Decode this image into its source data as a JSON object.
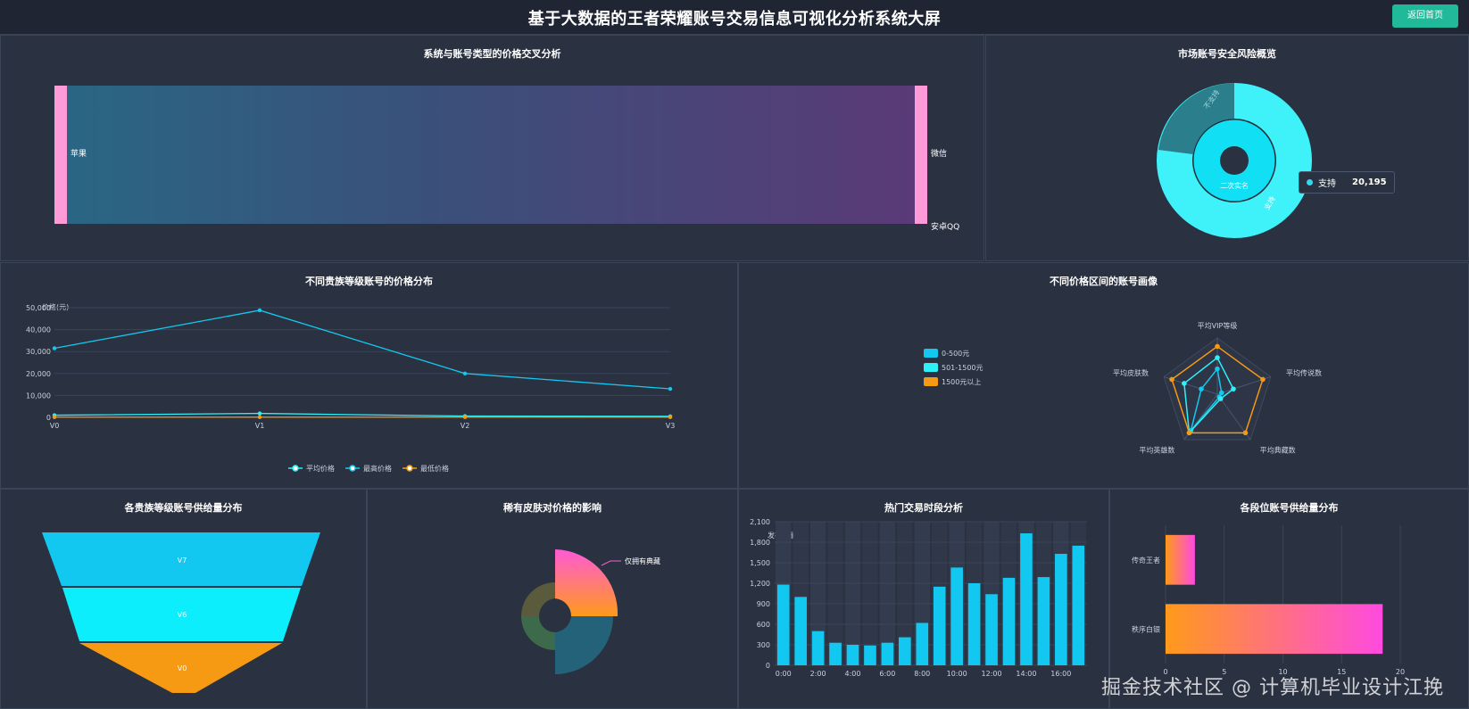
{
  "header": {
    "title": "基于大数据的王者荣耀账号交易信息可视化分析系统大屏",
    "home_button": "返回首页"
  },
  "colors": {
    "cyan": "#13c8f0",
    "cyan_light": "#2ff0f8",
    "orange": "#f59a12",
    "pink": "#ff5ad6",
    "pink_bar": "#ff9ad8"
  },
  "watermark": "掘金技术社区 @ 计算机毕业设计江挽",
  "charts": [
    {
      "type": "sankey",
      "title": "系统与账号类型的价格交叉分析",
      "nodes_left": [
        "苹果"
      ],
      "nodes_right": [
        "微信",
        "安卓QQ"
      ],
      "links": [
        {
          "source": "苹果",
          "target": "微信",
          "value": 1
        },
        {
          "source": "苹果",
          "target": "安卓QQ",
          "value": 0
        }
      ]
    },
    {
      "type": "pie",
      "title": "市场账号安全风险概览",
      "inner": [
        {
          "name": "二次实名",
          "value": 1
        }
      ],
      "outer": [
        {
          "name": "不支持",
          "value": 0.2
        },
        {
          "name": "支持",
          "value": 0.8
        }
      ],
      "tooltip": {
        "name": "支持",
        "value": "20,195"
      }
    },
    {
      "type": "line",
      "title": "不同贵族等级账号的价格分布",
      "ylabel": "价格(元)",
      "categories": [
        "V0",
        "V1",
        "V2",
        "V3"
      ],
      "yticks": [
        "0",
        "10,000",
        "20,000",
        "30,000",
        "40,000",
        "50,000"
      ],
      "ylim": [
        0,
        50000
      ],
      "series": [
        {
          "name": "平均价格",
          "values": [
            1000,
            1800,
            600,
            500
          ]
        },
        {
          "name": "最高价格",
          "values": [
            31500,
            48800,
            20000,
            13000
          ]
        },
        {
          "name": "最低价格",
          "values": [
            100,
            100,
            100,
            100
          ]
        }
      ]
    },
    {
      "type": "radar",
      "title": "不同价格区间的账号画像",
      "indicators": [
        "平均VIP等级",
        "平均传说数",
        "平均典藏数",
        "平均英雄数",
        "平均皮肤数"
      ],
      "series": [
        {
          "name": "0-500元",
          "values": [
            0.45,
            0.08,
            0.06,
            0.8,
            0.3
          ]
        },
        {
          "name": "501-1500元",
          "values": [
            0.65,
            0.3,
            0.1,
            0.85,
            0.62
          ]
        },
        {
          "name": "1500元以上",
          "values": [
            0.85,
            0.85,
            0.85,
            0.85,
            0.85
          ]
        }
      ]
    },
    {
      "type": "funnel",
      "title": "各贵族等级账号供给量分布",
      "categories": [
        "V7",
        "V6",
        "V0"
      ],
      "values": [
        3,
        2,
        1
      ]
    },
    {
      "type": "pie",
      "title": "稀有皮肤对价格的影响",
      "categories": [
        "仅拥有典藏"
      ],
      "label": "仅拥有典藏"
    },
    {
      "type": "bar",
      "title": "热门交易时段分析",
      "ylabel": "发布数量",
      "yticks": [
        "0",
        "300",
        "600",
        "900",
        "1,200",
        "1,500",
        "1,800",
        "2,100"
      ],
      "ylim": [
        0,
        2100
      ],
      "xticks": [
        "0:00",
        "2:00",
        "4:00",
        "6:00",
        "8:00",
        "10:00",
        "12:00",
        "14:00",
        "16:00"
      ],
      "values": [
        1180,
        1000,
        500,
        330,
        300,
        290,
        330,
        410,
        620,
        1150,
        1430,
        1200,
        1040,
        1280,
        1930,
        1290,
        1630,
        1750
      ]
    },
    {
      "type": "bar",
      "title": "各段位账号供给量分布",
      "orientation": "horizontal",
      "categories": [
        "传奇王者",
        "秩序白银"
      ],
      "values": [
        2.5,
        18.5
      ],
      "xticks": [
        "0",
        "5",
        "10",
        "15",
        "20"
      ],
      "xlim": [
        0,
        20
      ]
    }
  ]
}
